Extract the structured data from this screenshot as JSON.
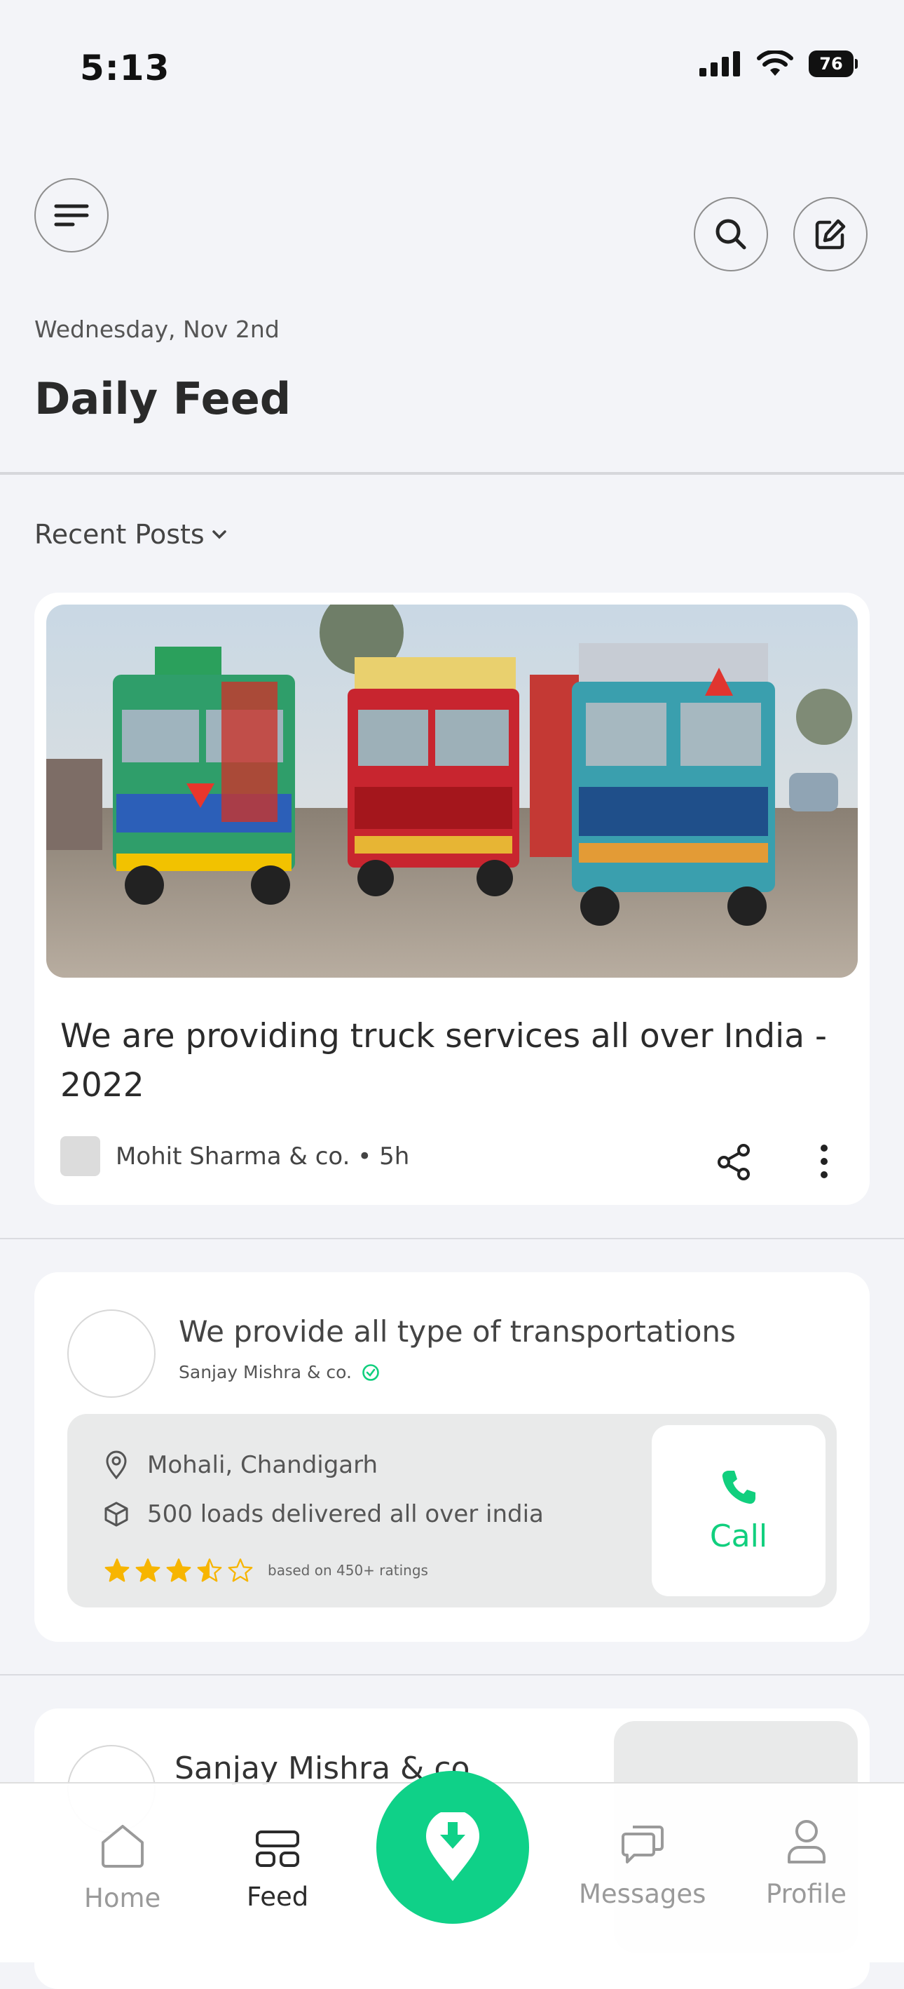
{
  "status_bar": {
    "time": "5:13",
    "battery": "76"
  },
  "header": {
    "date": "Wednesday, Nov 2nd",
    "title": "Daily Feed"
  },
  "filter": {
    "label": "Recent Posts"
  },
  "post": {
    "title": "We are providing truck services all over India - 2022",
    "author": "Mohit Sharma & co. • 5h"
  },
  "service_card": {
    "title": "We provide all type of transportations",
    "company": "Sanjay Mishra & co.",
    "location": "Mohali, Chandigarh",
    "loads": "500 loads delivered all over india",
    "rating": 3.5,
    "rating_max": 5,
    "rating_note": "based on 450+ ratings",
    "call_label": "Call"
  },
  "third_card": {
    "title": "Sanjay Mishra & co."
  },
  "nav": {
    "home": "Home",
    "feed": "Feed",
    "messages": "Messages",
    "profile": "Profile"
  },
  "colors": {
    "accent": "#0fd188",
    "star": "#f7b500",
    "background": "#f3f4f8"
  }
}
